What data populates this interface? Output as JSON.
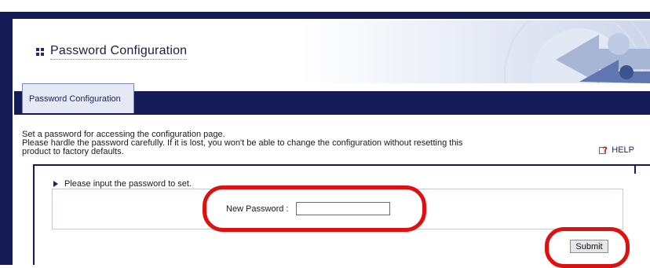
{
  "header": {
    "title": "Password Configuration",
    "icon": "grid-bullet-icon"
  },
  "tabs": [
    {
      "label": "Password Configuration",
      "active": true
    }
  ],
  "content": {
    "intro_line1": "Set a password for accessing the configuration page.",
    "intro_line2": "Please hardle the password carefully. If it is lost, you won't be able to change the configuration without resetting this",
    "intro_line3": "product to factory defaults.",
    "help_label": "HELP",
    "help_icon": "help-icon"
  },
  "form": {
    "instruction": "Please input the password to set.",
    "password_label": "New Password :",
    "password_value": "",
    "submit_label": "Submit"
  },
  "colors": {
    "frame": "#131c57",
    "tab_bg": "#e4e9f5",
    "annotation_ring": "#e01010"
  }
}
